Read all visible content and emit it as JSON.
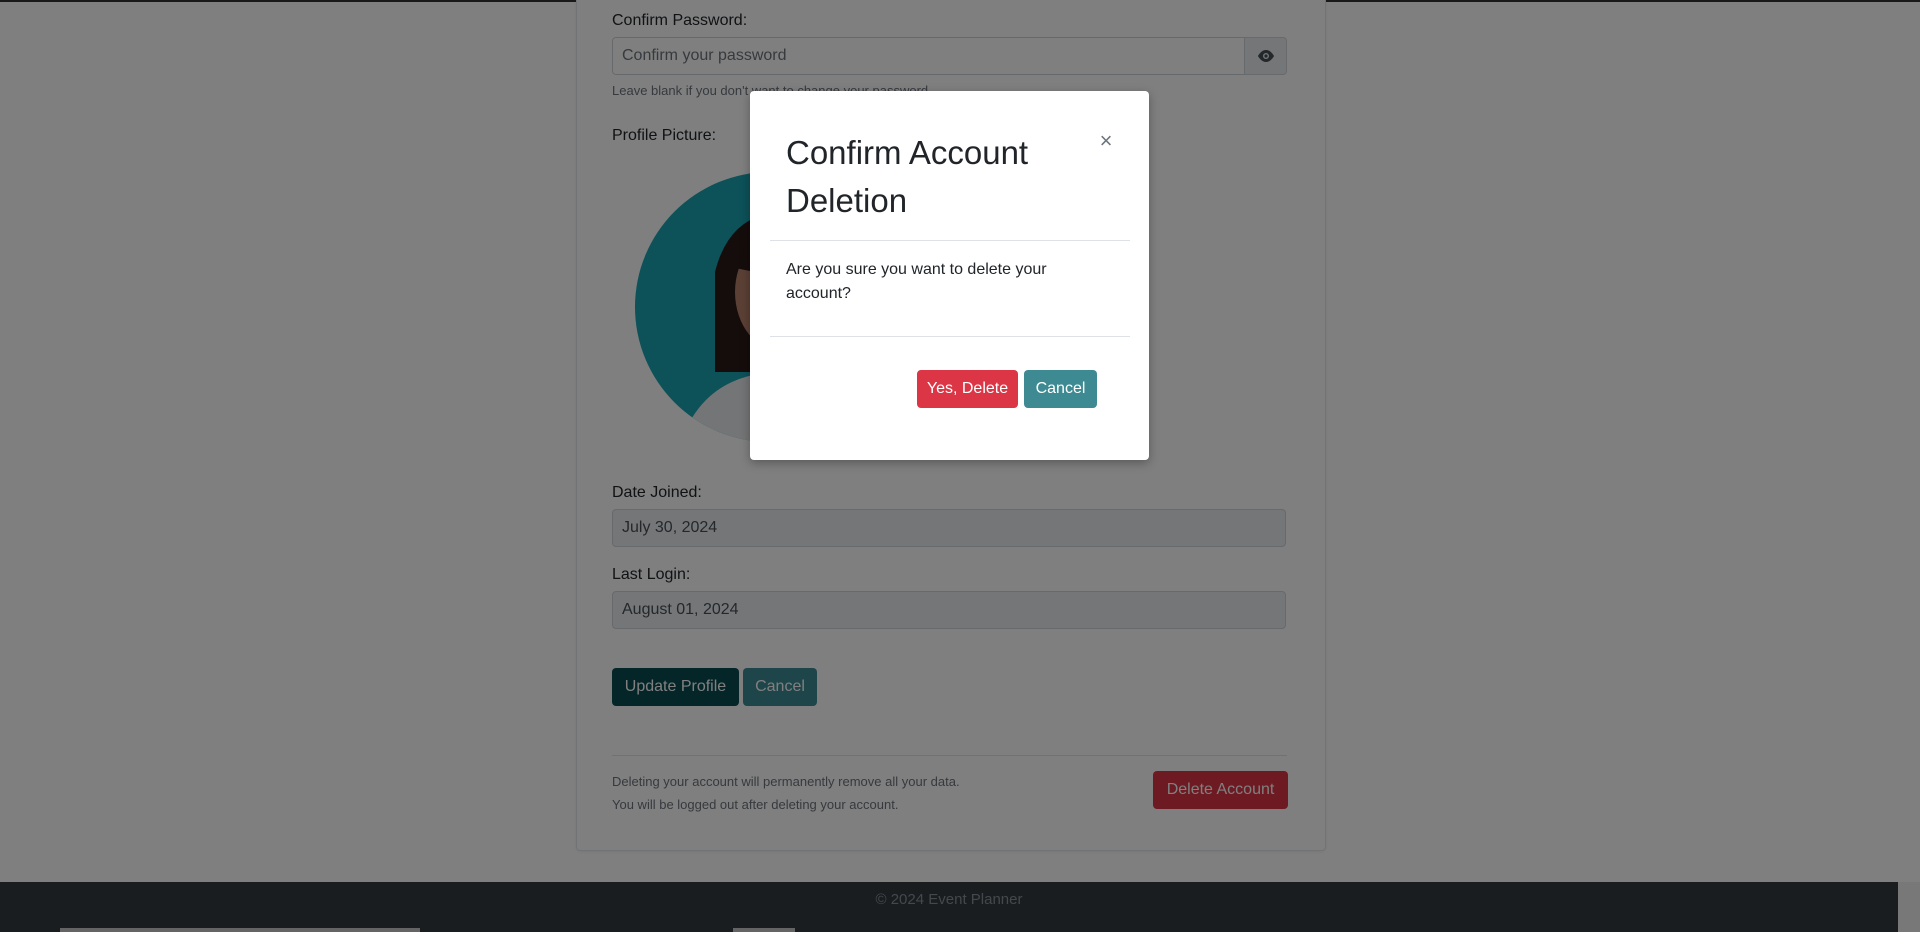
{
  "form": {
    "confirm_password_label": "Confirm Password:",
    "confirm_password_placeholder": "Confirm your password",
    "password_help": "Leave blank if you don't want to change your password.",
    "profile_picture_label": "Profile Picture:",
    "date_joined_label": "Date Joined:",
    "date_joined_value": "July 30, 2024",
    "last_login_label": "Last Login:",
    "last_login_value": "August 01, 2024",
    "update_button": "Update Profile",
    "cancel_button": "Cancel"
  },
  "danger_zone": {
    "warning_line1": "Deleting your account will permanently remove all your data.",
    "warning_line2": "You will be logged out after deleting your account.",
    "delete_button": "Delete Account"
  },
  "footer": {
    "text": "© 2024 Event Planner"
  },
  "modal": {
    "title": "Confirm Account Deletion",
    "close_symbol": "×",
    "body": "Are you sure you want to delete your account?",
    "confirm_button": "Yes, Delete",
    "cancel_button": "Cancel"
  },
  "icons": {
    "password_toggle": "eye-icon"
  },
  "colors": {
    "primary_dark": "#0b4d52",
    "secondary_teal": "#3d8a93",
    "danger": "#dc3545",
    "footer_bg": "#343a40",
    "avatar_bg": "#1aa3b3"
  }
}
